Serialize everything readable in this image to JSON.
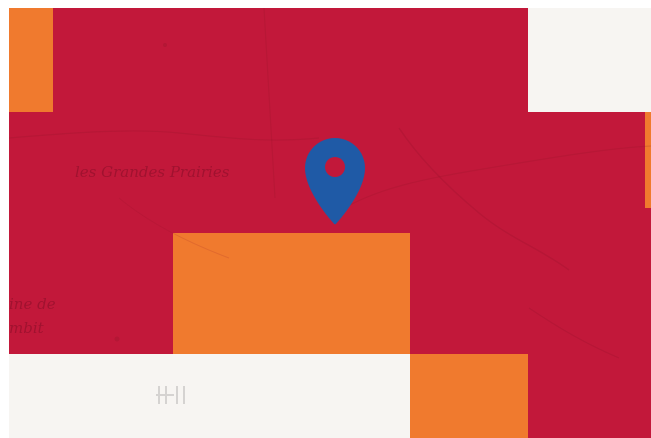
{
  "map": {
    "labels": {
      "grandes_prairies": "les Grandes Prairies",
      "left_line_1": "ine de",
      "left_line_2": "mbit"
    },
    "colors": {
      "red": "#C2183A",
      "orange": "#F07A2E",
      "white": "#F7F5F2",
      "marker": "#1F5AA6",
      "marker_dot": "#C2183A"
    },
    "marker": {
      "icon": "map-pin-icon"
    }
  }
}
